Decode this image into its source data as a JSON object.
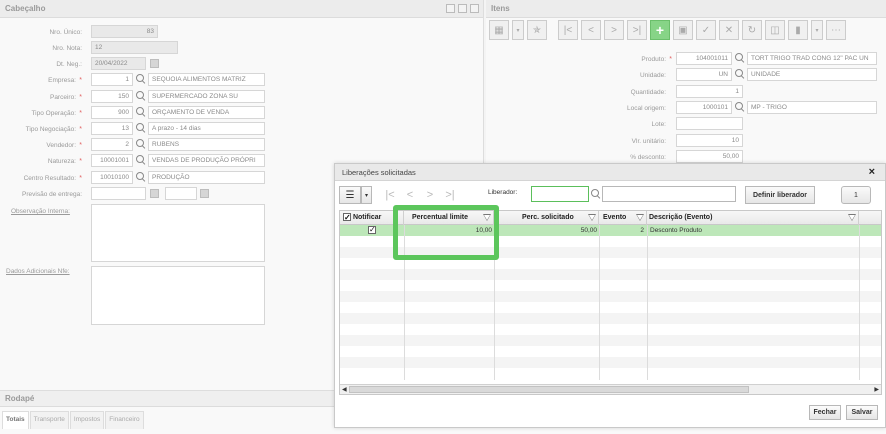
{
  "cabecalho": {
    "title": "Cabeçalho",
    "fields": [
      {
        "label": "Nro. Único:",
        "value": "83"
      },
      {
        "label": "Nro. Nota:",
        "value": "12"
      },
      {
        "label": "Dt. Neg.:",
        "value": "20/04/2022"
      },
      {
        "label": "Empresa:",
        "code": "1",
        "desc": "SEQUOIA ALIMENTOS MATRIZ"
      },
      {
        "label": "Parceiro:",
        "code": "150",
        "desc": "SUPERMERCADO ZONA SU"
      },
      {
        "label": "Tipo Operação:",
        "code": "900",
        "desc": "ORÇAMENTO DE VENDA"
      },
      {
        "label": "Tipo Negociação:",
        "code": "13",
        "desc": "A prazo - 14 dias"
      },
      {
        "label": "Vendedor:",
        "code": "2",
        "desc": "RUBENS"
      },
      {
        "label": "Natureza:",
        "code": "10001001",
        "desc": "VENDAS DE PRODUÇÃO PRÓPRI"
      },
      {
        "label": "Centro Resultado:",
        "code": "10010100",
        "desc": "PRODUÇÃO"
      },
      {
        "label": "Previsão de entrega:"
      }
    ],
    "obs_label": "Observação Interna:",
    "dados_label": "Dados Adicionais Nfe:"
  },
  "rodape": {
    "title": "Rodapé",
    "tabs": [
      "Totais",
      "Transporte",
      "Impostos",
      "Financeiro"
    ]
  },
  "itens": {
    "title": "Itens",
    "fields": [
      {
        "label": "Produto:",
        "code": "104001011",
        "desc": "TORT TRIGO TRAD CONG 12\" PAC UN"
      },
      {
        "label": "Unidade:",
        "code": "UN",
        "desc": "UNIDADE"
      },
      {
        "label": "Quantidade:",
        "value": "1"
      },
      {
        "label": "Local origem:",
        "code": "1000101",
        "desc": "MP - TRIGO"
      },
      {
        "label": "Lote:",
        "value": ""
      },
      {
        "label": "Vlr. unitário:",
        "value": "10"
      },
      {
        "label": "% desconto:",
        "value": "50,00"
      }
    ]
  },
  "dialog": {
    "title": "Liberações solicitadas",
    "close": "×",
    "liberador_label": "Liberador:",
    "liberador_value": "",
    "definir_label": "Definir liberador",
    "page": "1",
    "columns": {
      "notificar": "Notificar",
      "percentual_limite": "Percentual limite",
      "perc_solicitado": "Perc. solicitado",
      "evento": "Evento",
      "descricao": "Descrição (Evento)"
    },
    "rows": [
      {
        "notificar": true,
        "percentual_limite": "10,00",
        "perc_solicitado": "50,00",
        "evento": "2",
        "descricao": "Desconto Produto"
      }
    ],
    "fechar": "Fechar",
    "salvar": "Salvar"
  },
  "colors": {
    "accent": "#5cc65c",
    "selected_row": "#bde7b9",
    "required": "#e06060"
  },
  "icons": [
    "list-icon",
    "first-page-icon",
    "prev-page-icon",
    "next-page-icon",
    "last-page-icon",
    "search-icon",
    "filter-icon",
    "close-icon",
    "checkbox-icon"
  ]
}
